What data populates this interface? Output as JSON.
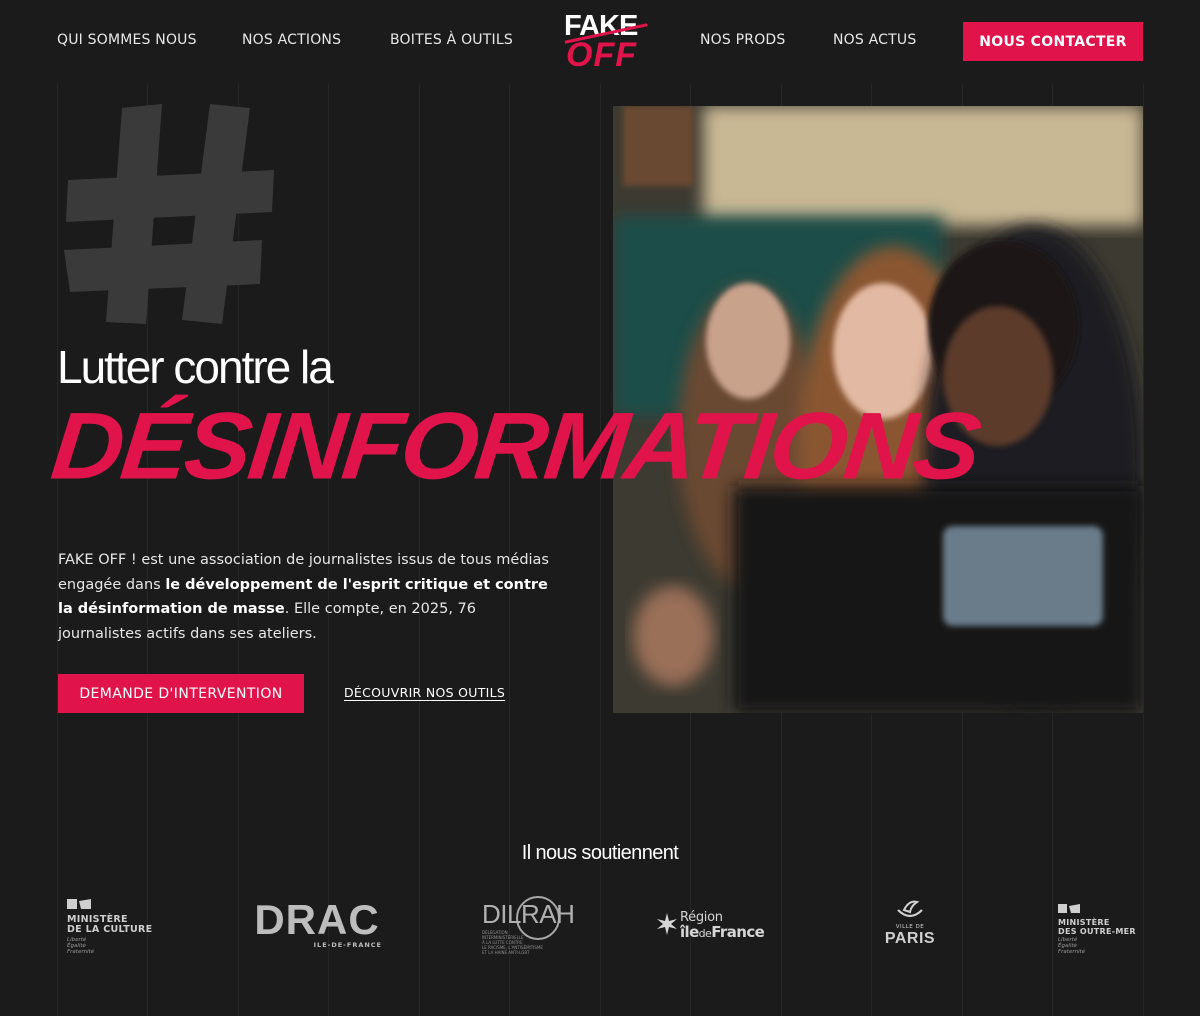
{
  "nav": {
    "items": [
      {
        "label": "QUI SOMMES NOUS"
      },
      {
        "label": "NOS ACTIONS"
      },
      {
        "label": "BOITES À OUTILS"
      },
      {
        "label": "NOS PRODS"
      },
      {
        "label": "NOS ACTUS"
      }
    ],
    "contact_label": "NOUS CONTACTER"
  },
  "logo": {
    "top": "FAKE",
    "bottom": "OFF"
  },
  "hero": {
    "heading": "Lutter contre la",
    "brush_word": "DÉSINFORMATIONS",
    "text_part1": "FAKE OFF ! est une association de journalistes issus de tous médias engagée dans ",
    "text_bold": "le développement de l'esprit critique et contre la désinformation de masse",
    "text_part2": ". Elle compte, en 2025, 76 journalistes actifs dans ses ateliers.",
    "cta_primary": "DEMANDE D'INTERVENTION",
    "cta_secondary": "DÉCOUVRIR NOS OUTILS"
  },
  "supporters": {
    "title": "Il nous soutiennent",
    "logos": [
      {
        "line1": "MINISTÈRE",
        "line2": "DE LA CULTURE",
        "motto1": "Liberté",
        "motto2": "Égalité",
        "motto3": "Fraternité"
      },
      {
        "name": "DRAC",
        "sub": "ILE-DE-FRANCE"
      },
      {
        "name": "DILRAH",
        "sub1": "DÉLÉGATION",
        "sub2": "INTERMINISTÉRIELLE",
        "sub3": "À LA LUTTE CONTRE",
        "sub4": "LE RACISME, L'ANTISÉMITISME",
        "sub5": "ET LA HAINE ANTI-LGBT"
      },
      {
        "line1": "Région",
        "line2a": "île",
        "line2b": "de",
        "line2c": "France"
      },
      {
        "line1": "VILLE DE",
        "line2": "PARIS"
      },
      {
        "line1": "MINISTÈRE",
        "line2": "DES OUTRE-MER",
        "motto1": "Liberté",
        "motto2": "Égalité",
        "motto3": "Fraternité"
      }
    ]
  },
  "colors": {
    "accent": "#e0134a",
    "background": "#1b1b1b"
  }
}
